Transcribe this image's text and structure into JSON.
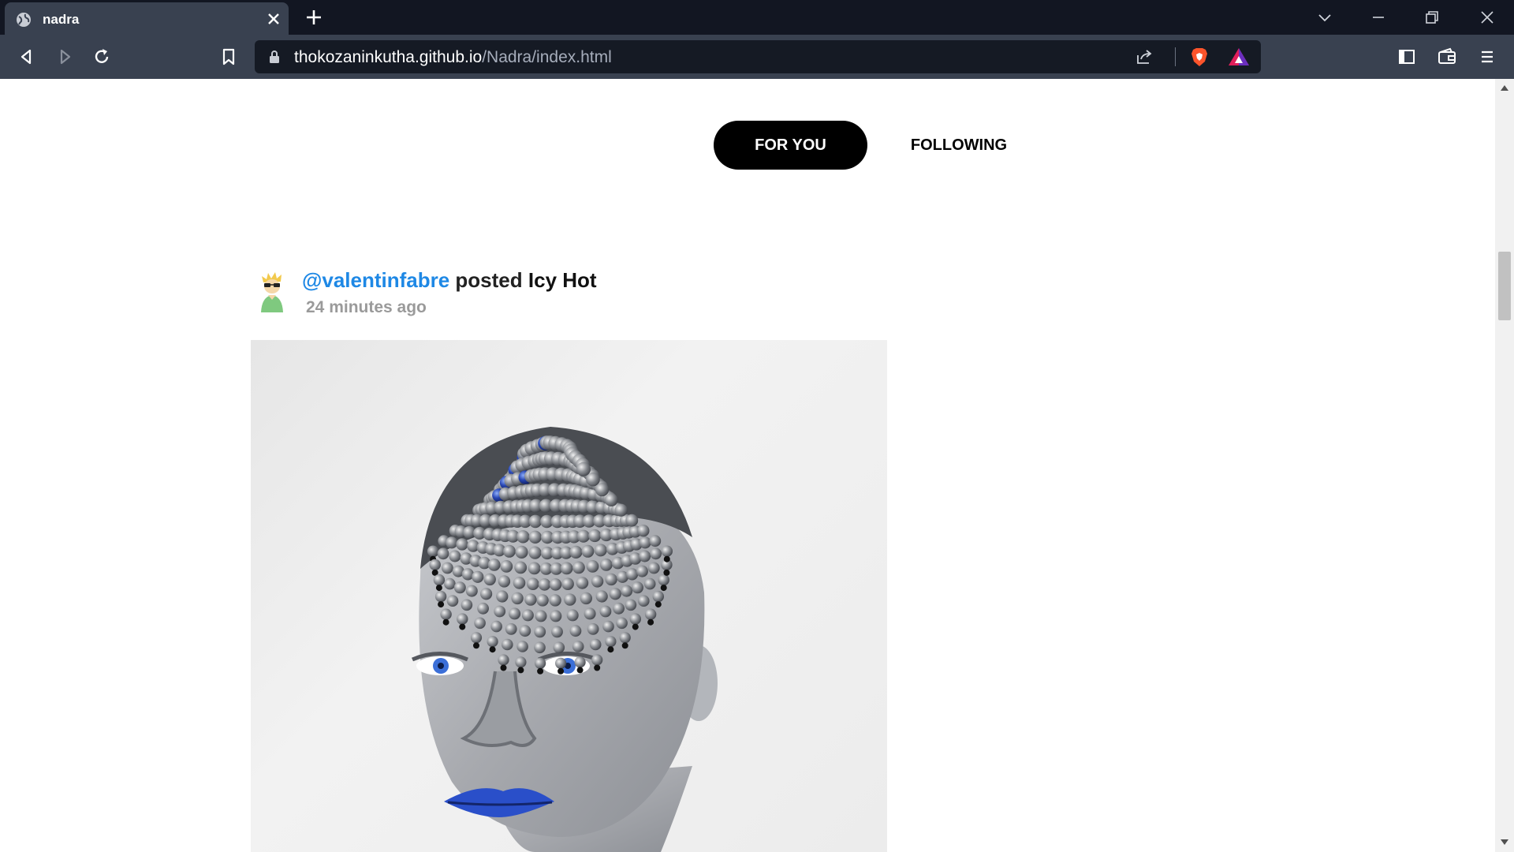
{
  "browser": {
    "tab_title": "nadra",
    "url_domain": "thokozaninkutha.github.io",
    "url_path": "/Nadra/index.html"
  },
  "feed": {
    "tabs": [
      {
        "label": "FOR YOU",
        "active": true
      },
      {
        "label": "FOLLOWING",
        "active": false
      }
    ]
  },
  "post": {
    "username": "@valentinfabre",
    "verb": "posted",
    "title": "Icy Hot",
    "time": "24 minutes ago"
  },
  "colors": {
    "username": "#1e88e5",
    "active_tab_bg": "#000000"
  }
}
